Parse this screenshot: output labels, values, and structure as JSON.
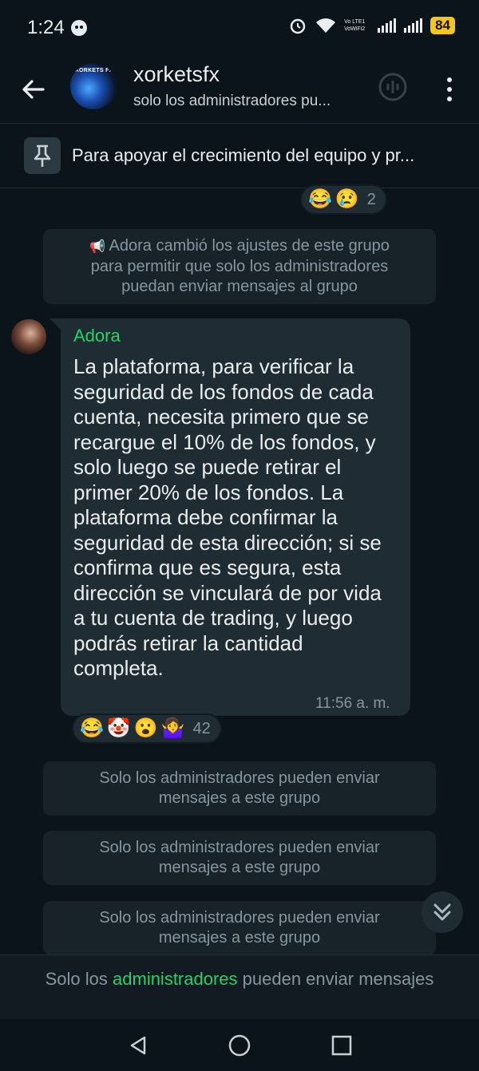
{
  "status_bar": {
    "time": "1:24",
    "battery": "84",
    "network_label": "Vo LTE1 VoWiFi2"
  },
  "header": {
    "group_name": "xorketsfx",
    "subtitle": "solo los administradores pu...",
    "avatar_text": "XORKETS FX"
  },
  "pinned": {
    "text": "Para apoyar el crecimiento del equipo y pr..."
  },
  "top_reactions": {
    "emojis": [
      "😂",
      "😢"
    ],
    "count": "2"
  },
  "system_message": {
    "icon": "📢",
    "text_line1": "Adora cambió los ajustes de este grupo",
    "text_line2": "para permitir que solo los administradores",
    "text_line3": "puedan enviar mensajes al grupo"
  },
  "message": {
    "sender": "Adora",
    "body": "La plataforma, para verificar la seguridad de los fondos de cada cuenta, necesita primero que se recargue el 10% de los fondos, y solo luego se puede retirar el primer 20% de los fondos. La plataforma debe confirmar la seguridad de esta dirección; si se confirma que es segura, esta dirección se vinculará de por vida a tu cuenta de trading, y luego podrás retirar la cantidad completa.",
    "time": "11:56 a. m.",
    "reactions": [
      "😂",
      "🤡",
      "😮",
      "🤷‍♀️"
    ],
    "reaction_count": "42"
  },
  "admin_notices": [
    {
      "line1": "Solo los administradores pueden enviar",
      "line2": "mensajes a este grupo"
    },
    {
      "line1": "Solo los administradores pueden enviar",
      "line2": "mensajes a este grupo"
    },
    {
      "line1": "Solo los administradores pueden enviar",
      "line2": "mensajes a este grupo"
    }
  ],
  "bottom_bar": {
    "prefix": "Solo los ",
    "accent": "administradores",
    "suffix": " pueden enviar mensajes",
    "accent_color": "#25d366"
  }
}
